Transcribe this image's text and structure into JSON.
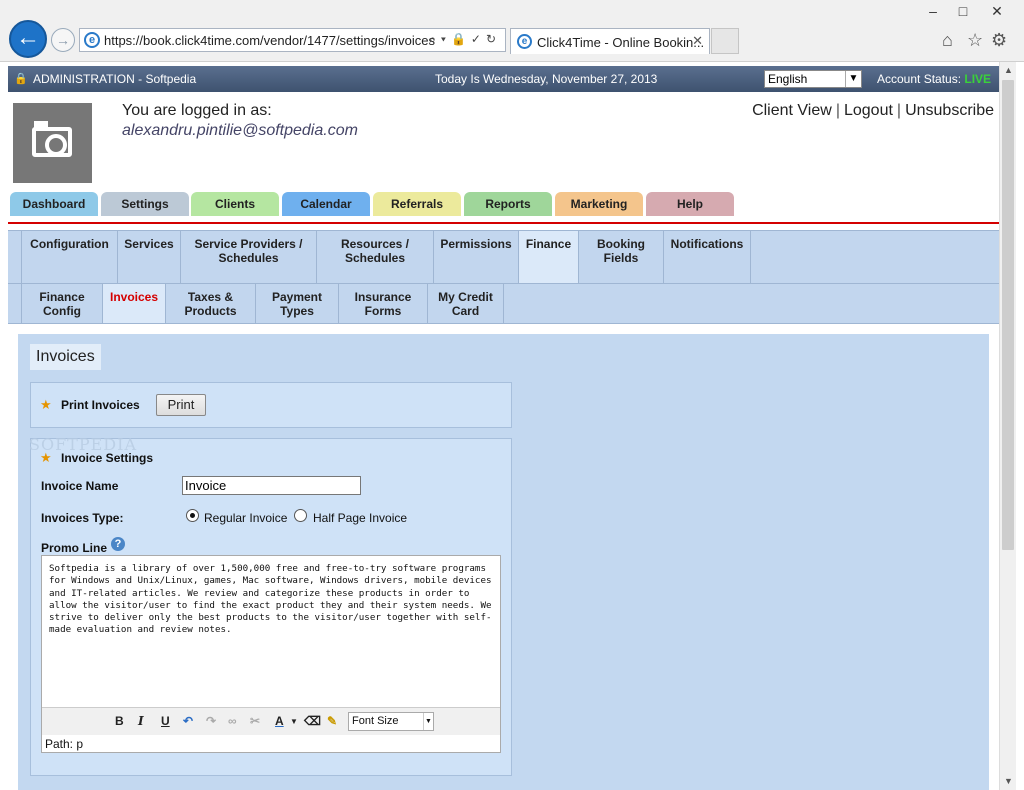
{
  "browser": {
    "url": "https://book.click4time.com/vendor/1477/settings/invoices",
    "url_display": "https://book.click4time.com/vendor/1477/settings/invoices",
    "tab_title": "Click4Time - Online Bookin...",
    "window_controls": [
      "minimize-icon",
      "maximize-icon",
      "close-icon"
    ]
  },
  "admin_bar": {
    "title": "ADMINISTRATION - Softpedia",
    "date": "Today Is Wednesday, November 27, 2013",
    "language": "English",
    "account_status_label": "Account Status:",
    "account_status_value": "LIVE"
  },
  "user": {
    "logged_in_label": "You are logged in as:",
    "email": "alexandru.pintilie@softpedia.com"
  },
  "top_links": [
    "Client View",
    "Logout",
    "Unsubscribe"
  ],
  "main_tabs": [
    {
      "label": "Dashboard",
      "color": "#8ec9e8"
    },
    {
      "label": "Settings",
      "color": "#bcc9d6"
    },
    {
      "label": "Clients",
      "color": "#b5e6a1"
    },
    {
      "label": "Calendar",
      "color": "#6fb0ee"
    },
    {
      "label": "Referrals",
      "color": "#ecea9c"
    },
    {
      "label": "Reports",
      "color": "#9fd69a"
    },
    {
      "label": "Marketing",
      "color": "#f4c58c"
    },
    {
      "label": "Help",
      "color": "#d6aab0"
    }
  ],
  "settings_tabs": [
    {
      "label": "Configuration"
    },
    {
      "label": "Services"
    },
    {
      "label": "Service Providers / Schedules"
    },
    {
      "label": "Resources / Schedules"
    },
    {
      "label": "Permissions"
    },
    {
      "label": "Finance"
    },
    {
      "label": "Booking Fields"
    },
    {
      "label": "Notifications"
    }
  ],
  "finance_tabs": [
    {
      "label": "Finance Config"
    },
    {
      "label": "Invoices"
    },
    {
      "label": "Taxes & Products"
    },
    {
      "label": "Payment Types"
    },
    {
      "label": "Insurance Forms"
    },
    {
      "label": "My Credit Card"
    }
  ],
  "section_title": "Invoices",
  "print_section": {
    "label": "Print Invoices",
    "button": "Print"
  },
  "settings_section": {
    "label": "Invoice Settings",
    "name_label": "Invoice Name",
    "name_value": "Invoice",
    "type_label": "Invoices Type:",
    "type_options": [
      "Regular Invoice",
      "Half Page Invoice"
    ],
    "type_selected": "Regular Invoice",
    "promo_label": "Promo Line",
    "promo_text": "Softpedia is a library of over 1,500,000 free and free-to-try software programs for Windows and Unix/Linux, games, Mac software, Windows drivers, mobile devices and IT-related articles. We review and categorize these products in order to allow the visitor/user to find the exact product they and their system needs. We strive to deliver only the best products to the visitor/user together with self-made evaluation and review notes.",
    "font_size_label": "Font Size",
    "path_text": "Path: p"
  },
  "watermark": "SOFTPEDIA"
}
